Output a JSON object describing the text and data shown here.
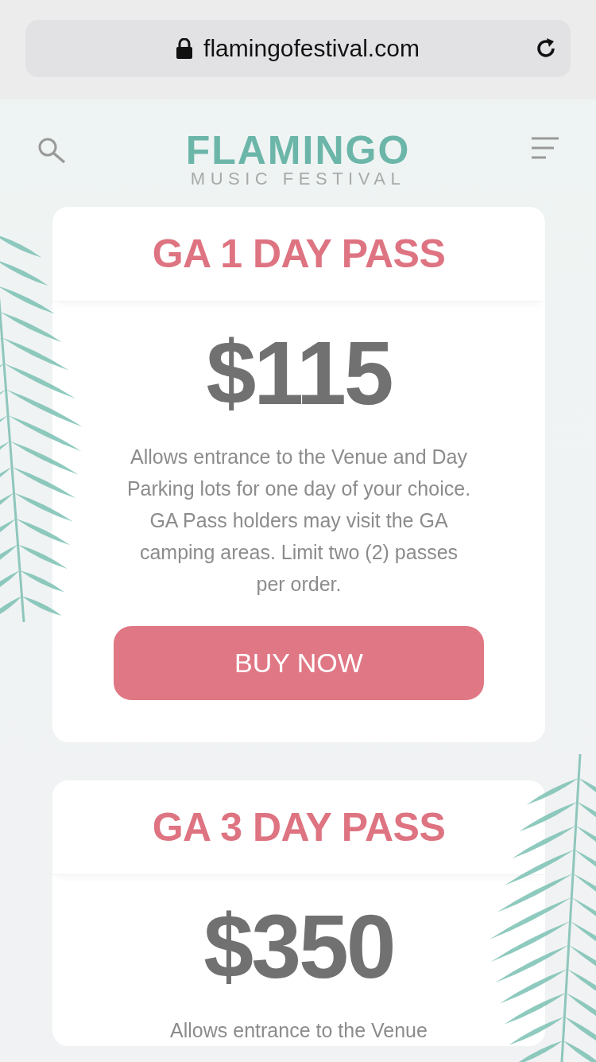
{
  "browser": {
    "url": "flamingofestival.com"
  },
  "header": {
    "logo_title": "FLAMINGO",
    "logo_subtitle": "MUSIC FESTIVAL"
  },
  "passes": [
    {
      "title": "GA 1 DAY PASS",
      "price": "$115",
      "description": "Allows entrance to the Venue and Day Parking lots for one day of your choice. GA Pass holders may visit the GA camping areas. Limit two (2) passes per order.",
      "button": "BUY NOW"
    },
    {
      "title": "GA 3 DAY PASS",
      "price": "$350",
      "description": "Allows entrance to the Venue"
    }
  ]
}
